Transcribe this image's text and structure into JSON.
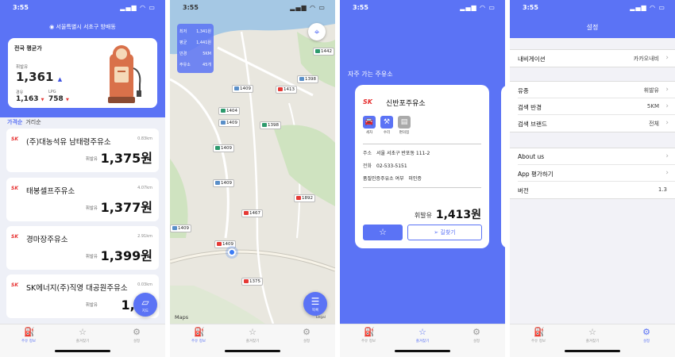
{
  "status": {
    "time": "3:55"
  },
  "tabs": {
    "info": "주유 정보",
    "fav": "즐겨찾기",
    "settings": "설정"
  },
  "home": {
    "location": "서울특별시 서초구 방배동",
    "avg_title": "전국 평균가",
    "gas_label": "휘발유",
    "gas_price": "1,361",
    "diesel_label": "경유",
    "diesel_price": "1,163",
    "lpg_label": "LPG",
    "lpg_price": "758",
    "sort_price": "가격순",
    "sort_distance": "거리순",
    "brand": "SK",
    "stations": [
      {
        "name": "(주)대농석유 남태령주유소",
        "dist": "0.83km",
        "fuel": "휘발유",
        "price": "1,375원"
      },
      {
        "name": "태봉셀프주유소",
        "dist": "4.07km",
        "fuel": "휘발유",
        "price": "1,377원"
      },
      {
        "name": "경마장주유소",
        "dist": "2.91km",
        "fuel": "휘발유",
        "price": "1,399원"
      },
      {
        "name": "SK에너지(주)직영 대공원주유소",
        "dist": "0.03km",
        "fuel": "휘발유",
        "price": "1,40"
      }
    ],
    "map_button": "지도"
  },
  "map": {
    "info": [
      {
        "k": "최저",
        "v": "1,341원"
      },
      {
        "k": "평균",
        "v": "1,441원"
      },
      {
        "k": "반경",
        "v": "5KM"
      },
      {
        "k": "주유소",
        "v": "45개"
      }
    ],
    "markers": [
      "1442",
      "1398",
      "1409",
      "1413",
      "1404",
      "1409",
      "1398",
      "1409",
      "1409",
      "1892",
      "1467",
      "1409",
      "1409",
      "1375"
    ],
    "apple_maps": "Maps",
    "legal": "Legal",
    "list_button": "목록"
  },
  "favorites": {
    "title": "자주 가는 주유소",
    "brand": "SK",
    "station_name": "신반포주유소",
    "services": [
      "세차",
      "수리",
      "편의점"
    ],
    "addr_k": "주소",
    "addr_v": "서울 서초구 반포동 111-2",
    "tel_k": "전화",
    "tel_v": "02-533-5151",
    "cert_k": "품질인증주유소 여부",
    "cert_v": "미인증",
    "fuel": "휘발유",
    "price": "1,413원",
    "nav_button": "길찾기"
  },
  "settings": {
    "title": "설정",
    "nav_label": "내비게이션",
    "nav_value": "카카오내비",
    "fuel_label": "유종",
    "fuel_value": "휘발유",
    "radius_label": "검색 반경",
    "radius_value": "5KM",
    "brand_label": "검색 브랜드",
    "brand_value": "전체",
    "about_label": "About us",
    "rate_label": "App 평가하기",
    "version_label": "버전",
    "version_value": "1.3"
  },
  "colors": {
    "accent": "#5b73f5",
    "up": "#3b4fe0",
    "down": "#e53935",
    "sk": "#e62e2e"
  }
}
